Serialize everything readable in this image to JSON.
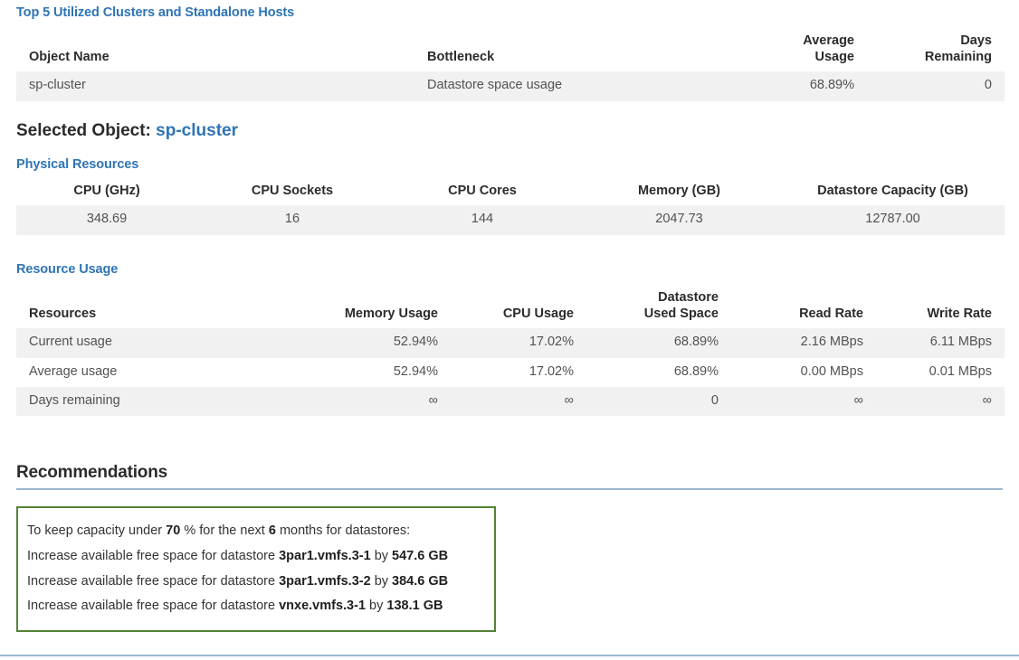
{
  "top_clusters": {
    "heading": "Top 5 Utilized Clusters and Standalone Hosts",
    "columns": [
      "Object Name",
      "Bottleneck",
      "Average Usage",
      "Days Remaining"
    ],
    "rows": [
      {
        "object_name": "sp-cluster",
        "bottleneck": "Datastore space usage",
        "average_usage": "68.89%",
        "days_remaining": "0",
        "days_remaining_critical": true
      }
    ]
  },
  "selected_object": {
    "label": "Selected Object:",
    "name": "sp-cluster"
  },
  "physical_resources": {
    "heading": "Physical Resources",
    "columns": [
      "CPU (GHz)",
      "CPU Sockets",
      "CPU Cores",
      "Memory (GB)",
      "Datastore Capacity (GB)"
    ],
    "rows": [
      {
        "cpu_ghz": "348.69",
        "cpu_sockets": "16",
        "cpu_cores": "144",
        "memory_gb": "2047.73",
        "datastore_capacity_gb": "12787.00"
      }
    ]
  },
  "resource_usage": {
    "heading": "Resource Usage",
    "columns": [
      "Resources",
      "Memory Usage",
      "CPU Usage",
      "Datastore Used Space",
      "Read Rate",
      "Write Rate"
    ],
    "rows": [
      {
        "resource": "Current usage",
        "memory_usage": "52.94%",
        "cpu_usage": "17.02%",
        "datastore_used_space": "68.89%",
        "read_rate": "2.16 MBps",
        "write_rate": "6.11 MBps"
      },
      {
        "resource": "Average usage",
        "memory_usage": "52.94%",
        "cpu_usage": "17.02%",
        "datastore_used_space": "68.89%",
        "read_rate": "0.00 MBps",
        "write_rate": "0.01 MBps"
      },
      {
        "resource": "Days remaining",
        "memory_usage": "∞",
        "cpu_usage": "∞",
        "datastore_used_space": "0",
        "read_rate": "∞",
        "write_rate": "∞"
      }
    ]
  },
  "recommendations": {
    "heading": "Recommendations",
    "intro": {
      "prefix": "To keep capacity under",
      "threshold": "70",
      "mid1": "% for the next",
      "months": "6",
      "suffix": "months for datastores:"
    },
    "items": [
      {
        "prefix": "Increase available free space for datastore",
        "datastore": "3par1.vmfs.3-1",
        "connector": "by",
        "amount": "547.6 GB"
      },
      {
        "prefix": "Increase available free space for datastore",
        "datastore": "3par1.vmfs.3-2",
        "connector": "by",
        "amount": "384.6 GB"
      },
      {
        "prefix": "Increase available free space for datastore",
        "datastore": "vnxe.vmfs.3-1",
        "connector": "by",
        "amount": "138.1 GB"
      }
    ]
  },
  "colors": {
    "heading_blue": "#2e74b5",
    "rule_blue": "#9cb6cf",
    "critical_red": "#e05a5a",
    "box_green": "#548235",
    "stripe_gray": "#f1f1f1"
  }
}
